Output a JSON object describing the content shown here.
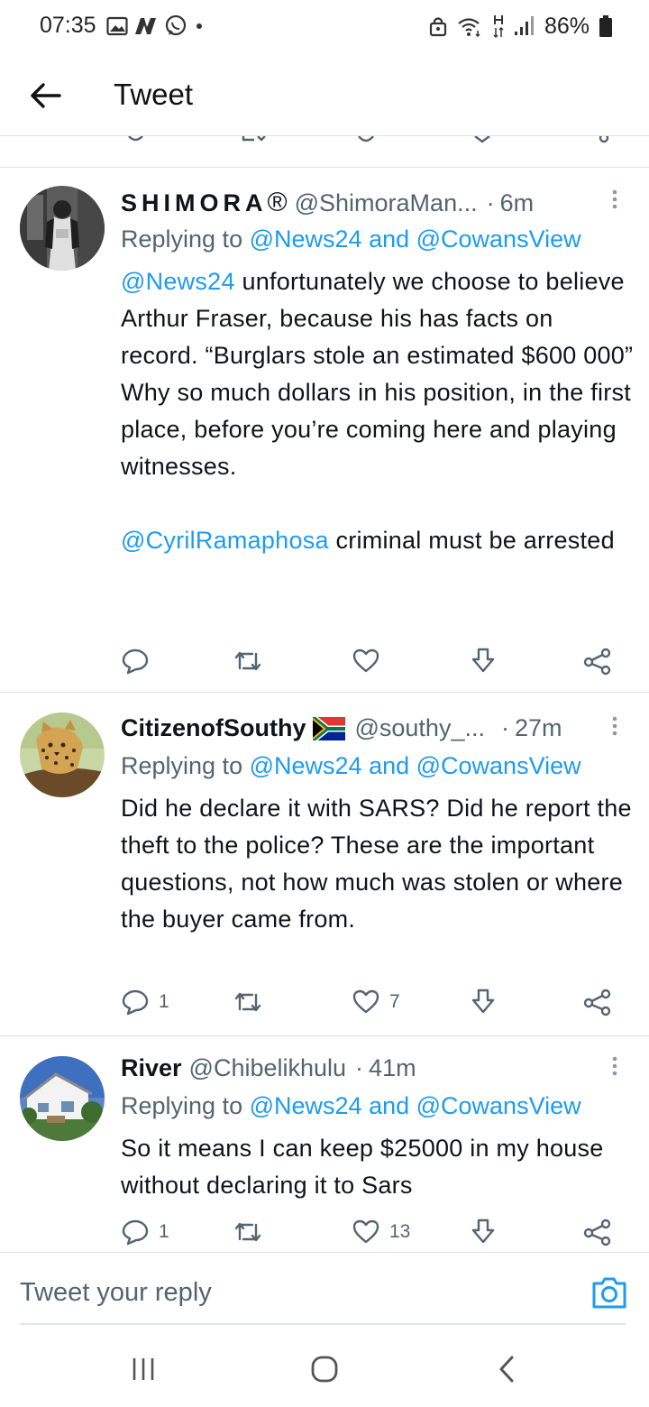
{
  "status_bar": {
    "time": "07:35",
    "battery": "86%"
  },
  "header": {
    "title": "Tweet"
  },
  "tweets": [
    {
      "name": "SHIMORA",
      "name_mark": "®",
      "handle": "@ShimoraMan...",
      "dot": "·",
      "time_ago": "6m",
      "replying_prefix": "Replying to",
      "replying_to": "@News24 and @CowansView",
      "body_parts": [
        {
          "mention": "@News24",
          "text": " unfortunately we choose to believe Arthur Fraser, because his has facts on record. “Burglars stole an estimated $600 000” Why so much dollars in his position, in the first place, before you’re coming here and playing witnesses."
        },
        {
          "mention": "@CyrilRamaphosa",
          "text": " criminal must be arrested"
        }
      ],
      "reply_count": "",
      "like_count": ""
    },
    {
      "name": "CitizenofSouthy",
      "handle": "@southy_...",
      "dot": "·",
      "time_ago": "27m",
      "replying_prefix": "Replying to",
      "replying_to": "@News24 and @CowansView",
      "body": "Did he declare it with SARS? Did he report the theft to the police? These are the important questions, not how much was stolen or where the buyer came from.",
      "reply_count": "1",
      "like_count": "7"
    },
    {
      "name": "River",
      "handle": "@Chibelikhulu",
      "dot": "·",
      "time_ago": "41m",
      "replying_prefix": "Replying to",
      "replying_to": "@News24 and @CowansView",
      "body": "So it means I can keep $25000 in my house without declaring it to Sars",
      "reply_count": "1",
      "like_count": "13"
    }
  ],
  "reply_bar": {
    "placeholder": "Tweet your reply"
  },
  "colors": {
    "accent": "#1d9bf0",
    "text": "#0f1419",
    "secondary": "#536471",
    "flag_green": "#007a4d",
    "flag_yellow": "#ffb612",
    "flag_red": "#de3831",
    "flag_blue": "#002395"
  }
}
